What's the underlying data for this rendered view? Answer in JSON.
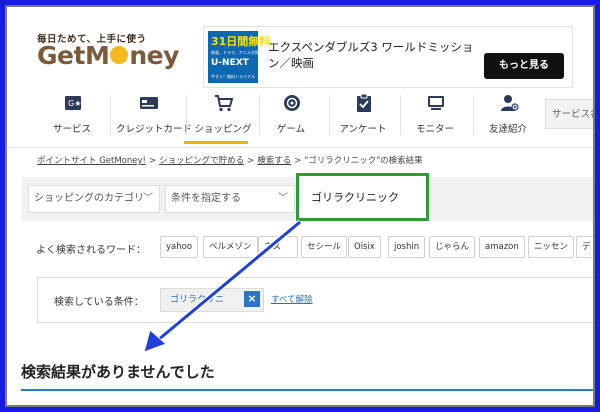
{
  "logo": {
    "tagline": "毎日ためて、上手に使う",
    "name_part1": "Get",
    "name_part2": "M",
    "name_part3": "ney"
  },
  "ad": {
    "img_line1": "31日間無料",
    "img_line2": "映画、ドラマ、アニメが見放題",
    "img_line3": "U-NEXT",
    "img_line4": "今すぐ！無料トライアル",
    "title": "エクスペンダブルズ3 ワールドミッション／映画",
    "button": "もっと見る"
  },
  "nav": {
    "items": [
      {
        "label": "サービス",
        "icon": "service-icon"
      },
      {
        "label": "クレジットカード",
        "icon": "credit-card-icon"
      },
      {
        "label": "ショッピング",
        "icon": "shopping-cart-icon"
      },
      {
        "label": "ゲーム",
        "icon": "game-icon"
      },
      {
        "label": "アンケート",
        "icon": "survey-icon"
      },
      {
        "label": "モニター",
        "icon": "monitor-icon"
      },
      {
        "label": "友達紹介",
        "icon": "friend-icon"
      }
    ],
    "search_placeholder": "サービス名"
  },
  "breadcrumb": {
    "items": [
      "ポイントサイト GetMoney!",
      "ショッピングで貯める",
      "検索する"
    ],
    "current": "\"ゴリラクリニック\"の検索結果",
    "separator": ">"
  },
  "filters": {
    "category": "ショッピングのカテゴリ",
    "condition": "条件を指定する",
    "keyword": "ゴリラクリニック"
  },
  "popular": {
    "label": "よく検索されるワード：",
    "words": [
      "yahoo",
      "ベルメゾン",
      "ネス",
      "セシール",
      "Oisix",
      "joshin",
      "じゃらん",
      "amazon",
      "ニッセン",
      "デ"
    ]
  },
  "condition": {
    "label": "検索している条件：",
    "chip": "ゴリラクリニ",
    "remove": "×",
    "clear_all": "すべて解除"
  },
  "result": {
    "message": "検索結果がありませんでした"
  },
  "colors": {
    "frame": "#1a1ae6",
    "highlight": "#2e9a35",
    "link": "#2e6fb7",
    "accent": "#f0b400",
    "arrow": "#1f3fd6"
  }
}
